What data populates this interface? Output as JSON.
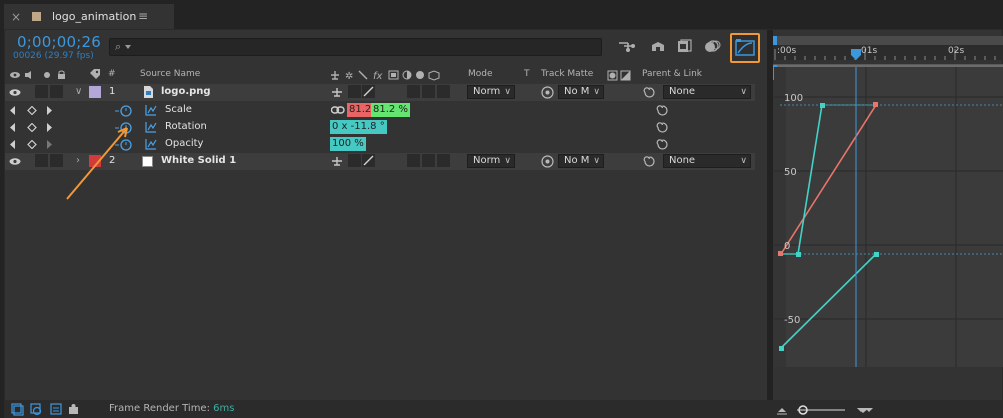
{
  "tab": {
    "close": "×",
    "title": "logo_animation",
    "menu": "≡"
  },
  "header": {
    "timecode": "0;00;00;26",
    "frames": "00026 (29.97 fps)",
    "search_icon": "⌕"
  },
  "columns": {
    "source_name": "Source Name",
    "mode": "Mode",
    "t": "T",
    "track_matte": "Track Matte",
    "parent_link": "Parent & Link",
    "hash": "#"
  },
  "layers": [
    {
      "index": "1",
      "name": "logo.png",
      "mode": "Norm",
      "matte": "No M",
      "parent": "None",
      "label_color": "#b3a7d9"
    },
    {
      "index": "2",
      "name": "White Solid 1",
      "mode": "Norm",
      "matte": "No M",
      "parent": "None",
      "label_color": "#d33b3b"
    }
  ],
  "properties": [
    {
      "name": "Scale",
      "value_a": "81.2",
      "value_b": "81.2 %"
    },
    {
      "name": "Rotation",
      "value": "0 x -11.8 °"
    },
    {
      "name": "Opacity",
      "value": "100 %"
    }
  ],
  "ruler": {
    "labels": [
      ":00s",
      "01s",
      "02s"
    ]
  },
  "graph": {
    "y_labels": [
      "100",
      "50",
      "0",
      "-50"
    ]
  },
  "footer": {
    "label": "Frame Render Time:",
    "value": "6ms"
  }
}
